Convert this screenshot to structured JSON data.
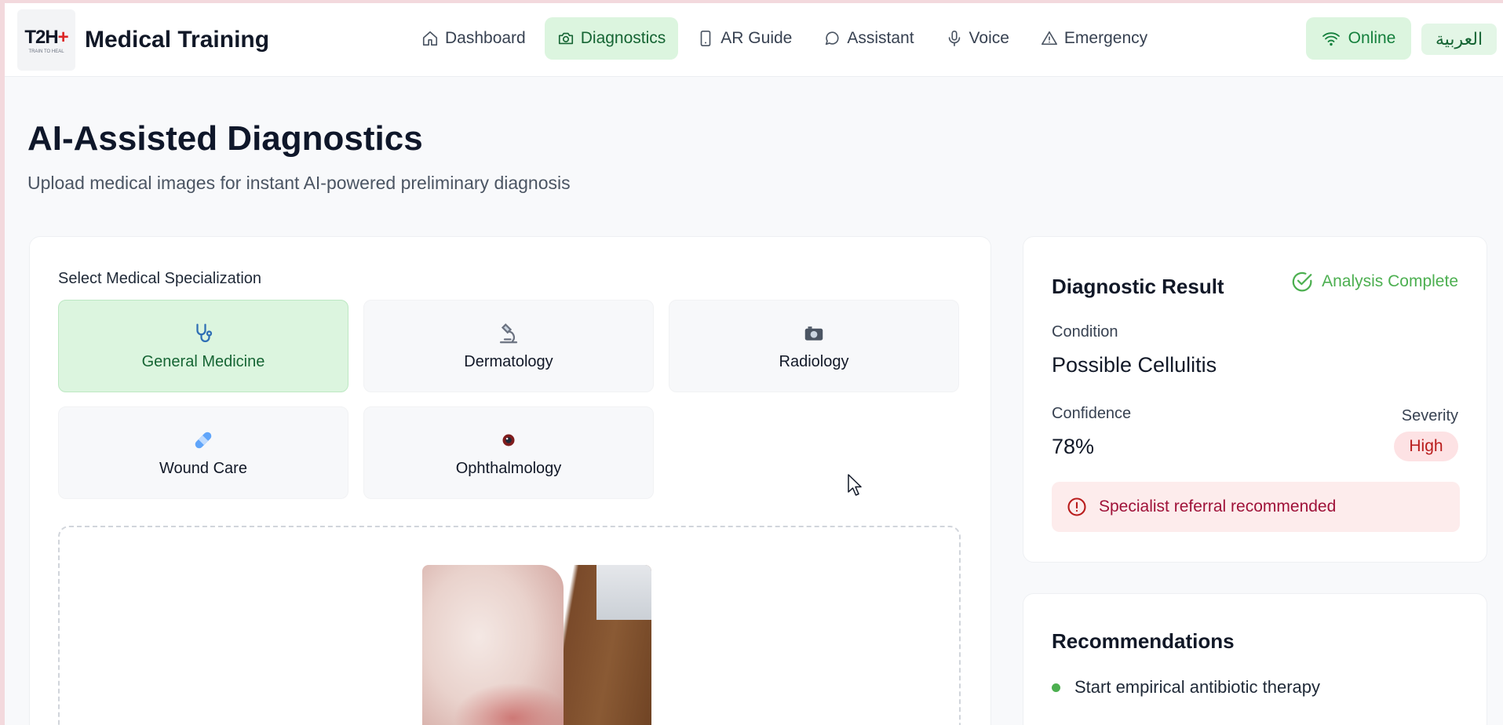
{
  "header": {
    "logo_text": "T2H",
    "logo_plus": "+",
    "logo_subtext": "TRAIN TO HEAL",
    "app_title": "Medical Training",
    "nav": [
      {
        "label": "Dashboard",
        "icon": "home-icon",
        "active": false
      },
      {
        "label": "Diagnostics",
        "icon": "camera-icon",
        "active": true
      },
      {
        "label": "AR Guide",
        "icon": "smartphone-icon",
        "active": false
      },
      {
        "label": "Assistant",
        "icon": "chat-bubble-icon",
        "active": false
      },
      {
        "label": "Voice",
        "icon": "microphone-icon",
        "active": false
      },
      {
        "label": "Emergency",
        "icon": "warning-triangle-icon",
        "active": false
      }
    ],
    "status_label": "Online",
    "status_icon": "wifi-icon",
    "language_label": "العربية"
  },
  "page": {
    "title": "AI-Assisted Diagnostics",
    "subtitle": "Upload medical images for instant AI-powered preliminary diagnosis"
  },
  "specialization": {
    "label": "Select Medical Specialization",
    "options": [
      {
        "label": "General Medicine",
        "icon": "stethoscope-icon",
        "selected": true
      },
      {
        "label": "Dermatology",
        "icon": "microscope-icon",
        "selected": false
      },
      {
        "label": "Radiology",
        "icon": "camera-icon",
        "selected": false
      },
      {
        "label": "Wound Care",
        "icon": "bandage-icon",
        "selected": false
      },
      {
        "label": "Ophthalmology",
        "icon": "eye-icon",
        "selected": false
      }
    ]
  },
  "upload": {
    "image_description_icon": "uploaded-leg-photo"
  },
  "result": {
    "title": "Diagnostic Result",
    "status": "Analysis Complete",
    "condition_label": "Condition",
    "condition_value": "Possible Cellulitis",
    "confidence_label": "Confidence",
    "confidence_value": "78%",
    "severity_label": "Severity",
    "severity_value": "High",
    "referral": "Specialist referral recommended"
  },
  "recommendations": {
    "title": "Recommendations",
    "items": [
      "Start empirical antibiotic therapy"
    ]
  },
  "colors": {
    "accent_green": "#4caf50",
    "active_bg": "#dcf5df",
    "danger": "#b91c1c"
  }
}
